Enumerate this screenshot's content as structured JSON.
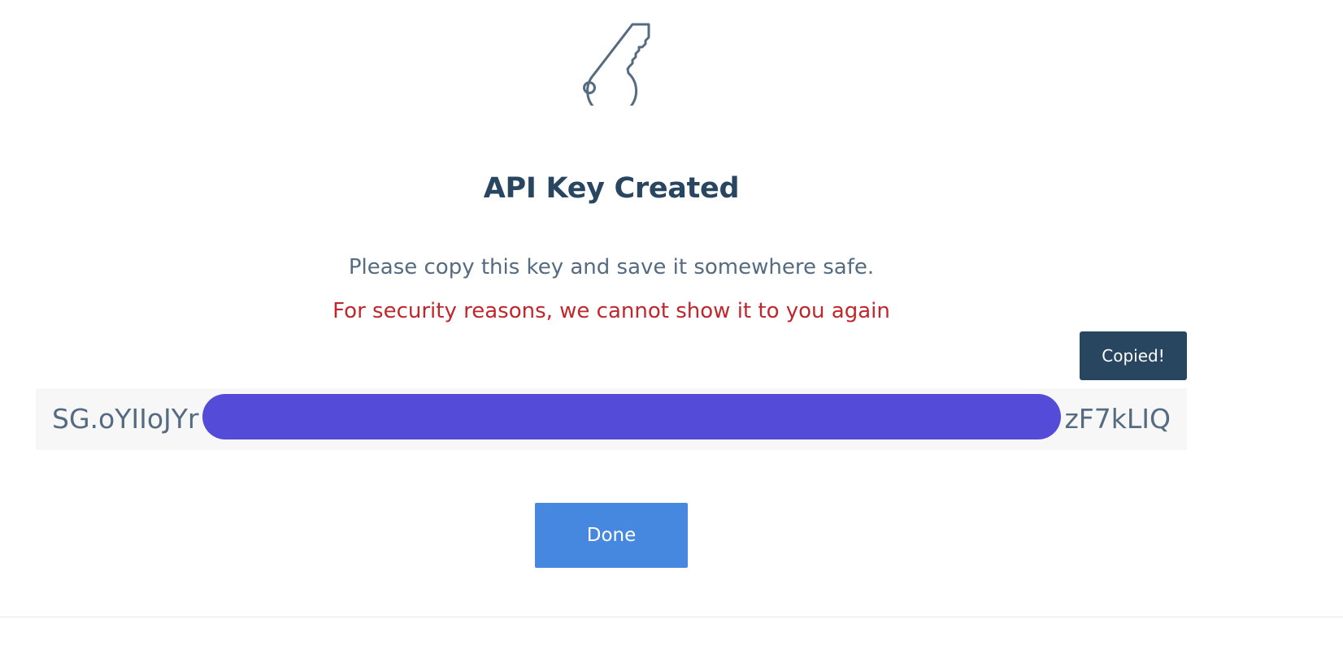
{
  "dialog": {
    "icon": "key-icon",
    "title": "API Key Created",
    "message": "Please copy this key and save it somewhere safe.",
    "warning": "For security reasons, we cannot show it to you again",
    "tooltip": "Copied!",
    "api_key": {
      "prefix": "SG.oYIIoJYr",
      "suffix": "zF7kLIQ",
      "redacted": true
    },
    "done_label": "Done"
  },
  "colors": {
    "title": "#294661",
    "text": "#546b81",
    "warning": "#c0272d",
    "tooltip_bg": "#294661",
    "key_field_bg": "#f7f7f7",
    "redaction": "#544bd8",
    "primary_button": "#4688e0"
  }
}
